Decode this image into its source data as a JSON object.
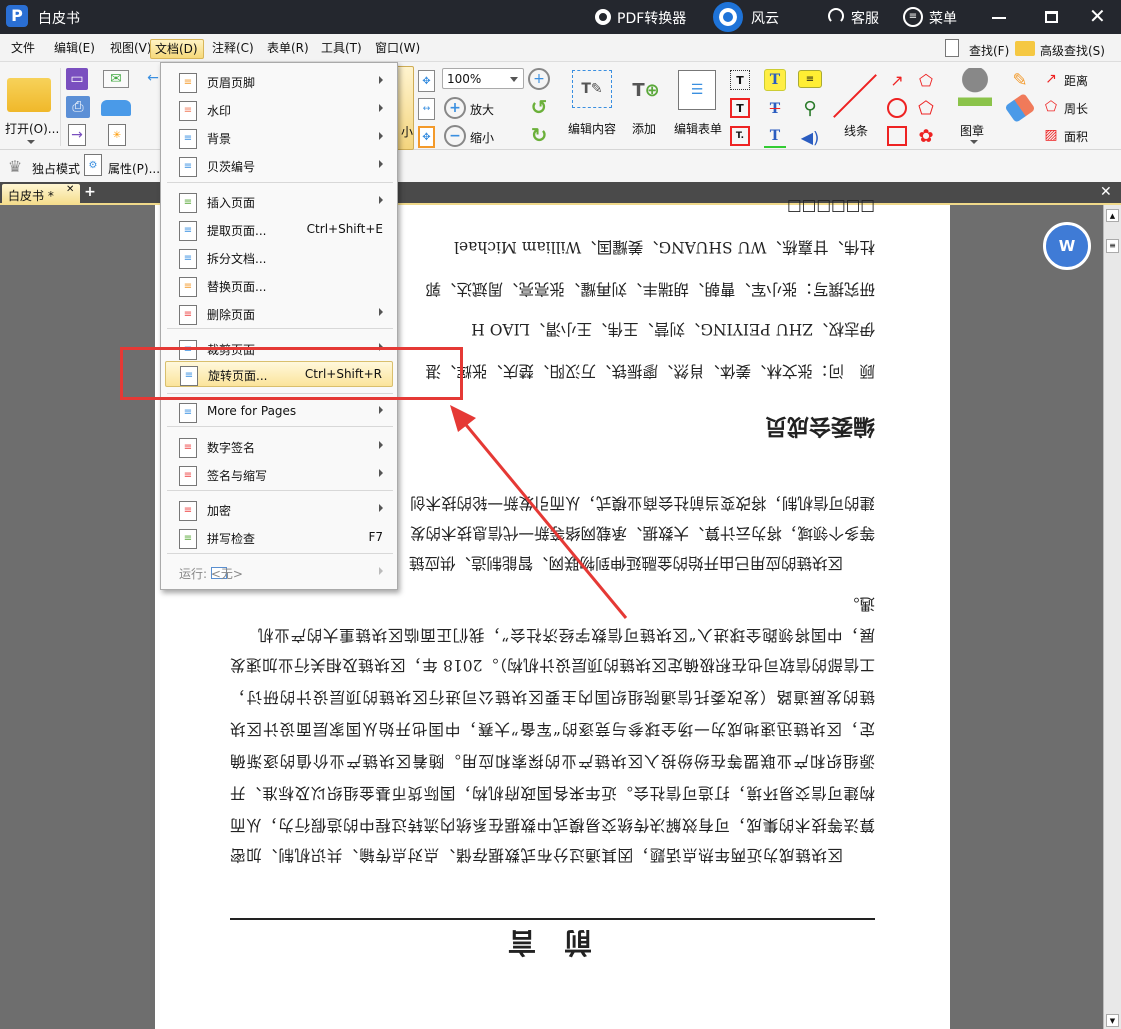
{
  "titlebar": {
    "app_title": "白皮书",
    "pdf_converter": "PDF转换器",
    "fengyun": "风云",
    "service": "客服",
    "menu": "菜单"
  },
  "menubar": {
    "items": [
      "文件",
      "编辑(E)",
      "视图(V)",
      "文档(D)",
      "注释(C)",
      "表单(R)",
      "工具(T)",
      "窗口(W)"
    ],
    "active": "文档(D)",
    "find": "查找(F)",
    "advanced_find": "高级查找(S)"
  },
  "toolbar": {
    "open": "打开(O)...",
    "shrink_partial": "小",
    "zoom_value": "100%",
    "zoom_in": "放大",
    "zoom_out": "缩小",
    "edit_content": "编辑内容",
    "add": "添加",
    "edit_form": "编辑表单",
    "lines": "线条",
    "stamp": "图章",
    "distance": "距离",
    "perimeter": "周长",
    "area": "面积",
    "exclusive_mode": "独占模式",
    "properties": "属性(P)..."
  },
  "tabs": [
    {
      "label": "白皮书 *",
      "active": true
    }
  ],
  "doc_menu": {
    "items": [
      {
        "label": "页眉页脚",
        "submenu": true,
        "icon": "header-footer-icon"
      },
      {
        "label": "水印",
        "submenu": true,
        "icon": "watermark-icon"
      },
      {
        "label": "背景",
        "submenu": true,
        "icon": "background-icon"
      },
      {
        "label": "贝茨编号",
        "submenu": true,
        "icon": "bates-number-icon"
      },
      {
        "label": "插入页面",
        "submenu": true,
        "icon": "insert-page-icon"
      },
      {
        "label": "提取页面...",
        "shortcut": "Ctrl+Shift+E",
        "icon": "extract-page-icon"
      },
      {
        "label": "拆分文档...",
        "icon": "split-document-icon"
      },
      {
        "label": "替换页面...",
        "icon": "replace-page-icon"
      },
      {
        "label": "删除页面",
        "submenu": true,
        "icon": "delete-page-icon"
      },
      {
        "label": "裁剪页面",
        "submenu": true,
        "icon": "crop-page-icon"
      },
      {
        "label": "旋转页面...",
        "shortcut": "Ctrl+Shift+R",
        "icon": "rotate-page-icon",
        "highlighted": true
      },
      {
        "label": "More for Pages",
        "submenu": true,
        "icon": "more-pages-icon"
      },
      {
        "label": "数字签名",
        "submenu": true,
        "icon": "digital-signature-icon"
      },
      {
        "label": "签名与缩写",
        "submenu": true,
        "icon": "sign-initial-icon"
      },
      {
        "label": "加密",
        "submenu": true,
        "icon": "encrypt-icon"
      },
      {
        "label": "拼写检查",
        "shortcut": "F7",
        "icon": "spell-check-icon"
      },
      {
        "label": "运行: <无>",
        "submenu": true,
        "disabled": true,
        "icon": "run-icon"
      }
    ]
  },
  "document": {
    "title": "前　言",
    "paragraph1": [
      "区块链成为近两年热点话题，因其通过分布式数据存储、点对点传输、共识机制、加密",
      "算法等技术的集成，可有效解决传统交易模式中数据在系统内流转过程中的造假行为，从而",
      "构建可信交易环境，打造可信社会。近年来各国政府机构，国际货币基金组织以及标准、开",
      "源组织和产业联盟等在纷纷投入区块链产业的探索和应用。随着区块链产业价值的逐渐确",
      "定，区块链迅速地成为一场全球参与竞逐的“军备”大赛，中国也开始从国家层面设计区块",
      "链的发展道路（发改委托信通院组织国内主要区块链公司进行区块链的顶层设计的研讨，",
      "工信部的信软司也在积极确定区块链的顶层设计机构）。2018 年，区块链及相关行业加速发",
      "展，中国将领跑全球进入“区块链可信数字经济社会”，我们正面临区块链重大的产业机",
      "遇。"
    ],
    "paragraph2": [
      "区块链的应用已由开始的金融延伸到物联网、智能制造、供应链",
      "等多个领域，将为云计算、大数据、承载网络等新一代信息技术的发",
      "建的可信机制，将改变当前社会商业模式，从而引发新一轮的技术创"
    ],
    "committee_heading": "编委会成员",
    "committee": [
      "顾　问：张文林、姜体、肖然、廖振铁、万汉阳、楚庆、张辉、湛",
      "伊志权、ZHU PEIYING、刘营、王伟、王小渭、LIAO H",
      "研究撰写：张小军、曹朝、胡瑞丰、刘再耀、张亮亮、周斌达、郭",
      "杜伟、甘嘉栋、WU SHUANG、姜耀国、William Michael"
    ]
  },
  "colors": {
    "titlebar": "#24272e",
    "highlight": "#fbe49b",
    "annotation": "#e53935",
    "float_button": "#3f7bd6"
  }
}
